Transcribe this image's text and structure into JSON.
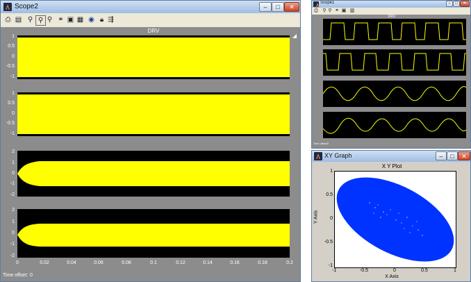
{
  "scope2": {
    "title": "Scope2",
    "plot_title": "DRV",
    "time_offset_label": "Time offset:",
    "time_offset_value": "0",
    "panels": [
      {
        "yticks": [
          "1",
          "0.5",
          "0",
          "-0.5",
          "-1"
        ]
      },
      {
        "yticks": [
          "1",
          "0.5",
          "0",
          "-0.5",
          "-1"
        ]
      },
      {
        "yticks": [
          "2",
          "1",
          "0",
          "-1",
          "-2"
        ]
      },
      {
        "yticks": [
          "2",
          "1",
          "0",
          "-1",
          "-2"
        ]
      }
    ],
    "xticks": [
      "0",
      "0.02",
      "0.04",
      "0.06",
      "0.08",
      "0.1",
      "0.12",
      "0.14",
      "0.16",
      "0.18",
      "0.2"
    ],
    "toolbar_icons": [
      "print-icon",
      "params-icon",
      "zoom-icon",
      "zoom-x-icon",
      "zoom-y-icon",
      "binoculars-icon",
      "save-axes-icon",
      "restore-axes-icon",
      "floating-scope-icon",
      "lock-icon",
      "signal-selector-icon"
    ],
    "signal_color": "#ffff00"
  },
  "scope1": {
    "title": "Scope1",
    "plot_title": "DRV",
    "time_offset_label": "Time offset:",
    "time_offset_value": "0"
  },
  "xygraph": {
    "title": "XY Graph",
    "plot_title": "X Y Plot",
    "xlabel": "X Axis",
    "ylabel": "Y Axis",
    "xticks": [
      "-1",
      "-0.5",
      "0",
      "0.5",
      "1"
    ],
    "yticks": [
      "1",
      "0.5",
      "0",
      "-0.5",
      "-1"
    ],
    "fill_color": "#0033ff"
  },
  "window_buttons": {
    "minimize": "–",
    "maximize": "□",
    "close": "✕"
  }
}
